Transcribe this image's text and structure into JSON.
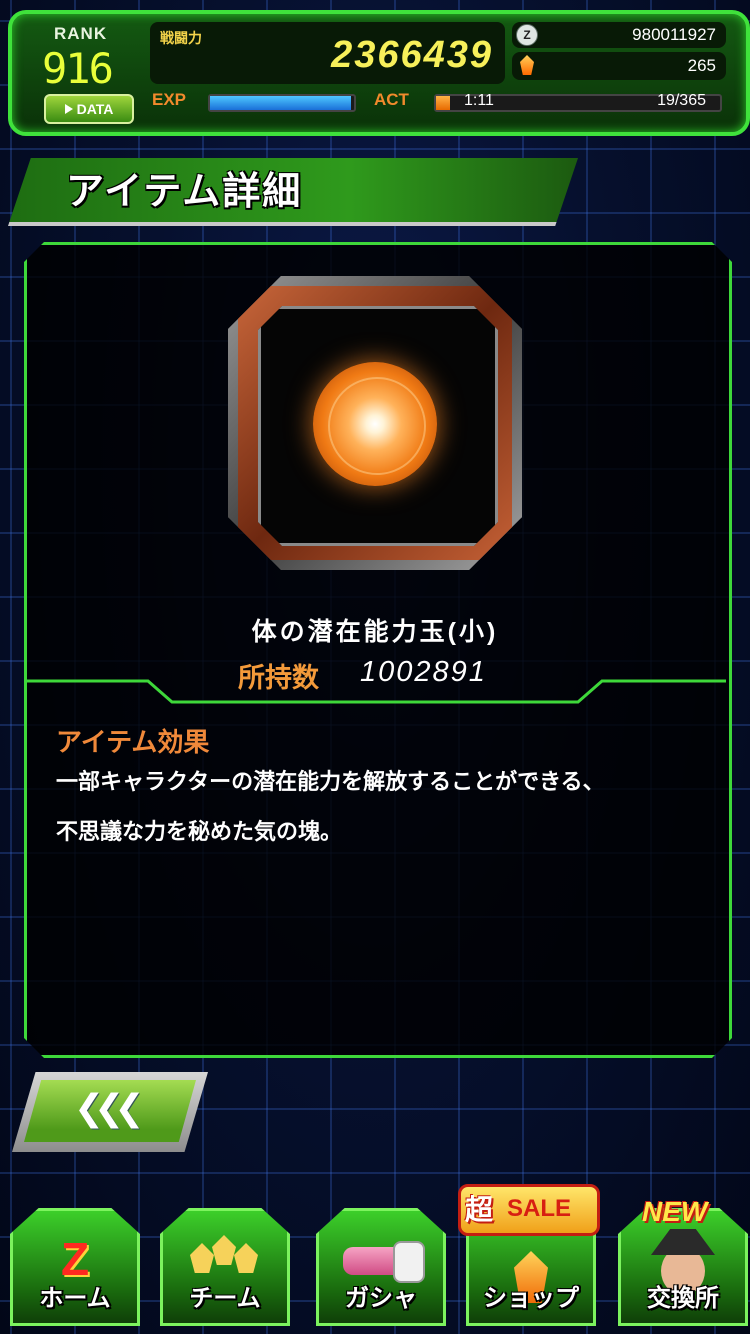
{
  "status": {
    "rank_label": "RANK",
    "rank_value": "916",
    "data_button_label": "DATA",
    "power_label": "戦闘力",
    "power_value": "2366439",
    "stones_value": "980011927",
    "stones_icon": "dragon-stone-icon",
    "gems_value": "265",
    "gems_icon": "gem-icon",
    "exp_label": "EXP",
    "exp_progress": 0.98,
    "act_label": "ACT",
    "act_time": "1:11",
    "act_count": "19/365",
    "act_progress": 0.05
  },
  "title": "アイテム詳細",
  "item": {
    "name": "体の潜在能力玉(小)",
    "qty_label": "所持数",
    "qty_value": "1002891",
    "effect_label": "アイテム効果",
    "effect_lines": [
      "一部キャラクターの潜在能力を解放することができる、",
      "不思議な力を秘めた気の塊。"
    ],
    "icon": "orange-potential-orb-icon"
  },
  "back_button": {
    "label": "❮❮❮"
  },
  "nav": {
    "items": [
      {
        "label": "ホーム",
        "icon": "z-logo-icon"
      },
      {
        "label": "チーム",
        "icon": "team-characters-icon"
      },
      {
        "label": "ガシャ",
        "icon": "gasha-scouter-icon"
      },
      {
        "label": "ショップ",
        "icon": "shop-gem-icon"
      },
      {
        "label": "交換所",
        "icon": "exchange-character-icon"
      }
    ],
    "sale_kanji": "超",
    "sale_text": "SALE",
    "new_text": "NEW"
  },
  "colors": {
    "frame_green": "#3fe23b",
    "accent_orange": "#f0893a",
    "power_yellow": "#f7f05a"
  }
}
